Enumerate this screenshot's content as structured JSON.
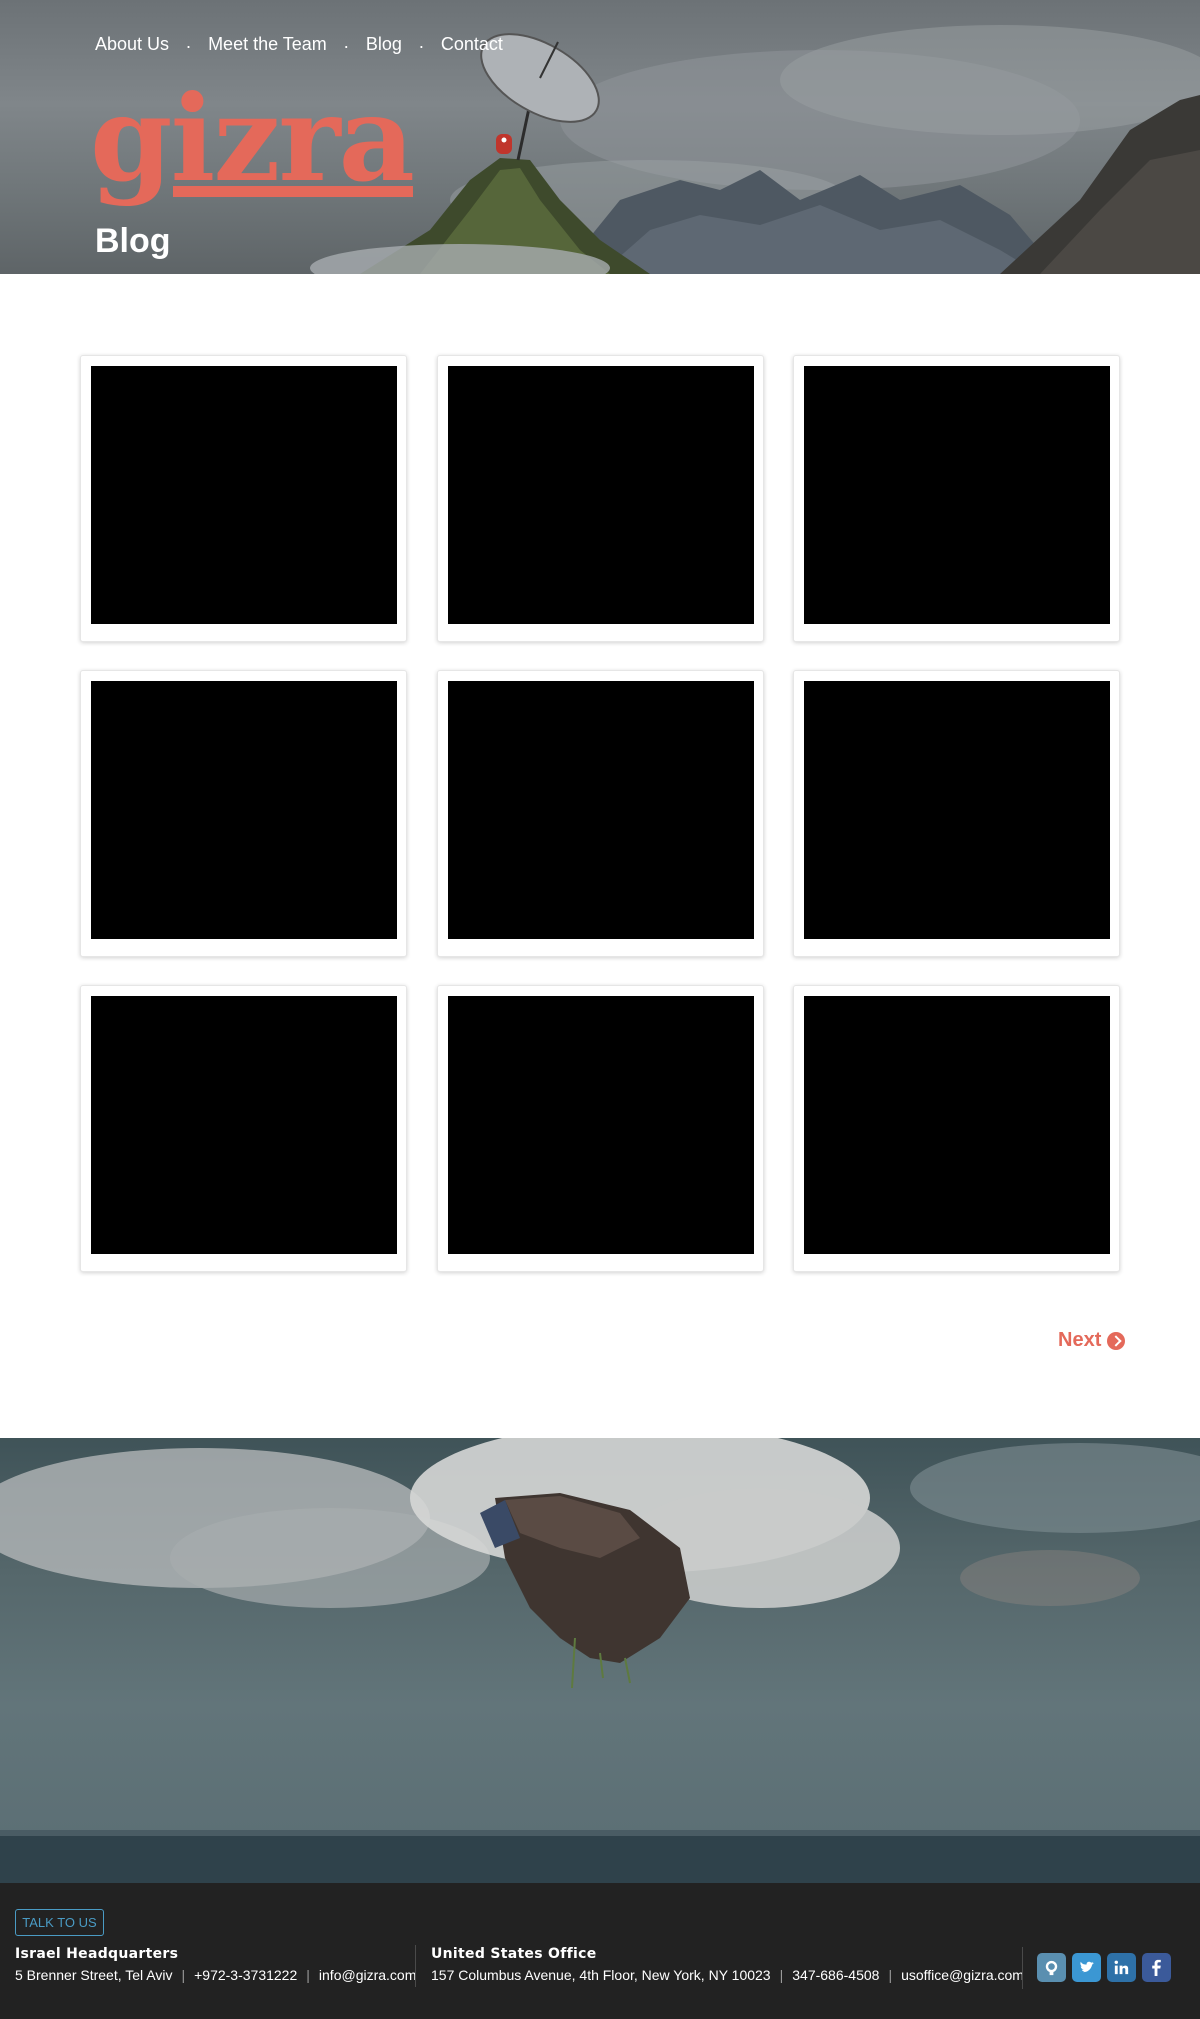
{
  "nav": {
    "items": [
      {
        "label": "About Us"
      },
      {
        "label": "Meet the Team"
      },
      {
        "label": "Blog"
      },
      {
        "label": "Contact"
      }
    ],
    "separator": "."
  },
  "brand": {
    "logo_text": "gizra",
    "accent_color": "#e4695a"
  },
  "page": {
    "title": "Blog"
  },
  "posts": [
    {
      "thumb_color": "#000000"
    },
    {
      "thumb_color": "#000000"
    },
    {
      "thumb_color": "#000000"
    },
    {
      "thumb_color": "#000000"
    },
    {
      "thumb_color": "#000000"
    },
    {
      "thumb_color": "#000000"
    },
    {
      "thumb_color": "#000000"
    },
    {
      "thumb_color": "#000000"
    },
    {
      "thumb_color": "#000000"
    }
  ],
  "pagination": {
    "next_label": "Next",
    "icon": "chevron-circle-right-icon"
  },
  "footer": {
    "cta_label": "Talk to us",
    "israel": {
      "heading": "Israel Headquarters",
      "address": "5 Brenner Street, Tel Aviv",
      "phone": "+972-3-3731222",
      "email": "info@gizra.com"
    },
    "us": {
      "heading": "United States Office",
      "address": "157 Columbus Avenue, 4th Floor, New York, NY 10023",
      "phone": "347-686-4508",
      "email": "usoffice@gizra.com"
    },
    "social": [
      {
        "icon": "github-icon",
        "color": "#5a8fb0"
      },
      {
        "icon": "twitter-icon",
        "color": "#3b97d3"
      },
      {
        "icon": "linkedin-icon",
        "color": "#2e71a8"
      },
      {
        "icon": "facebook-icon",
        "color": "#3b5a9a"
      }
    ]
  }
}
